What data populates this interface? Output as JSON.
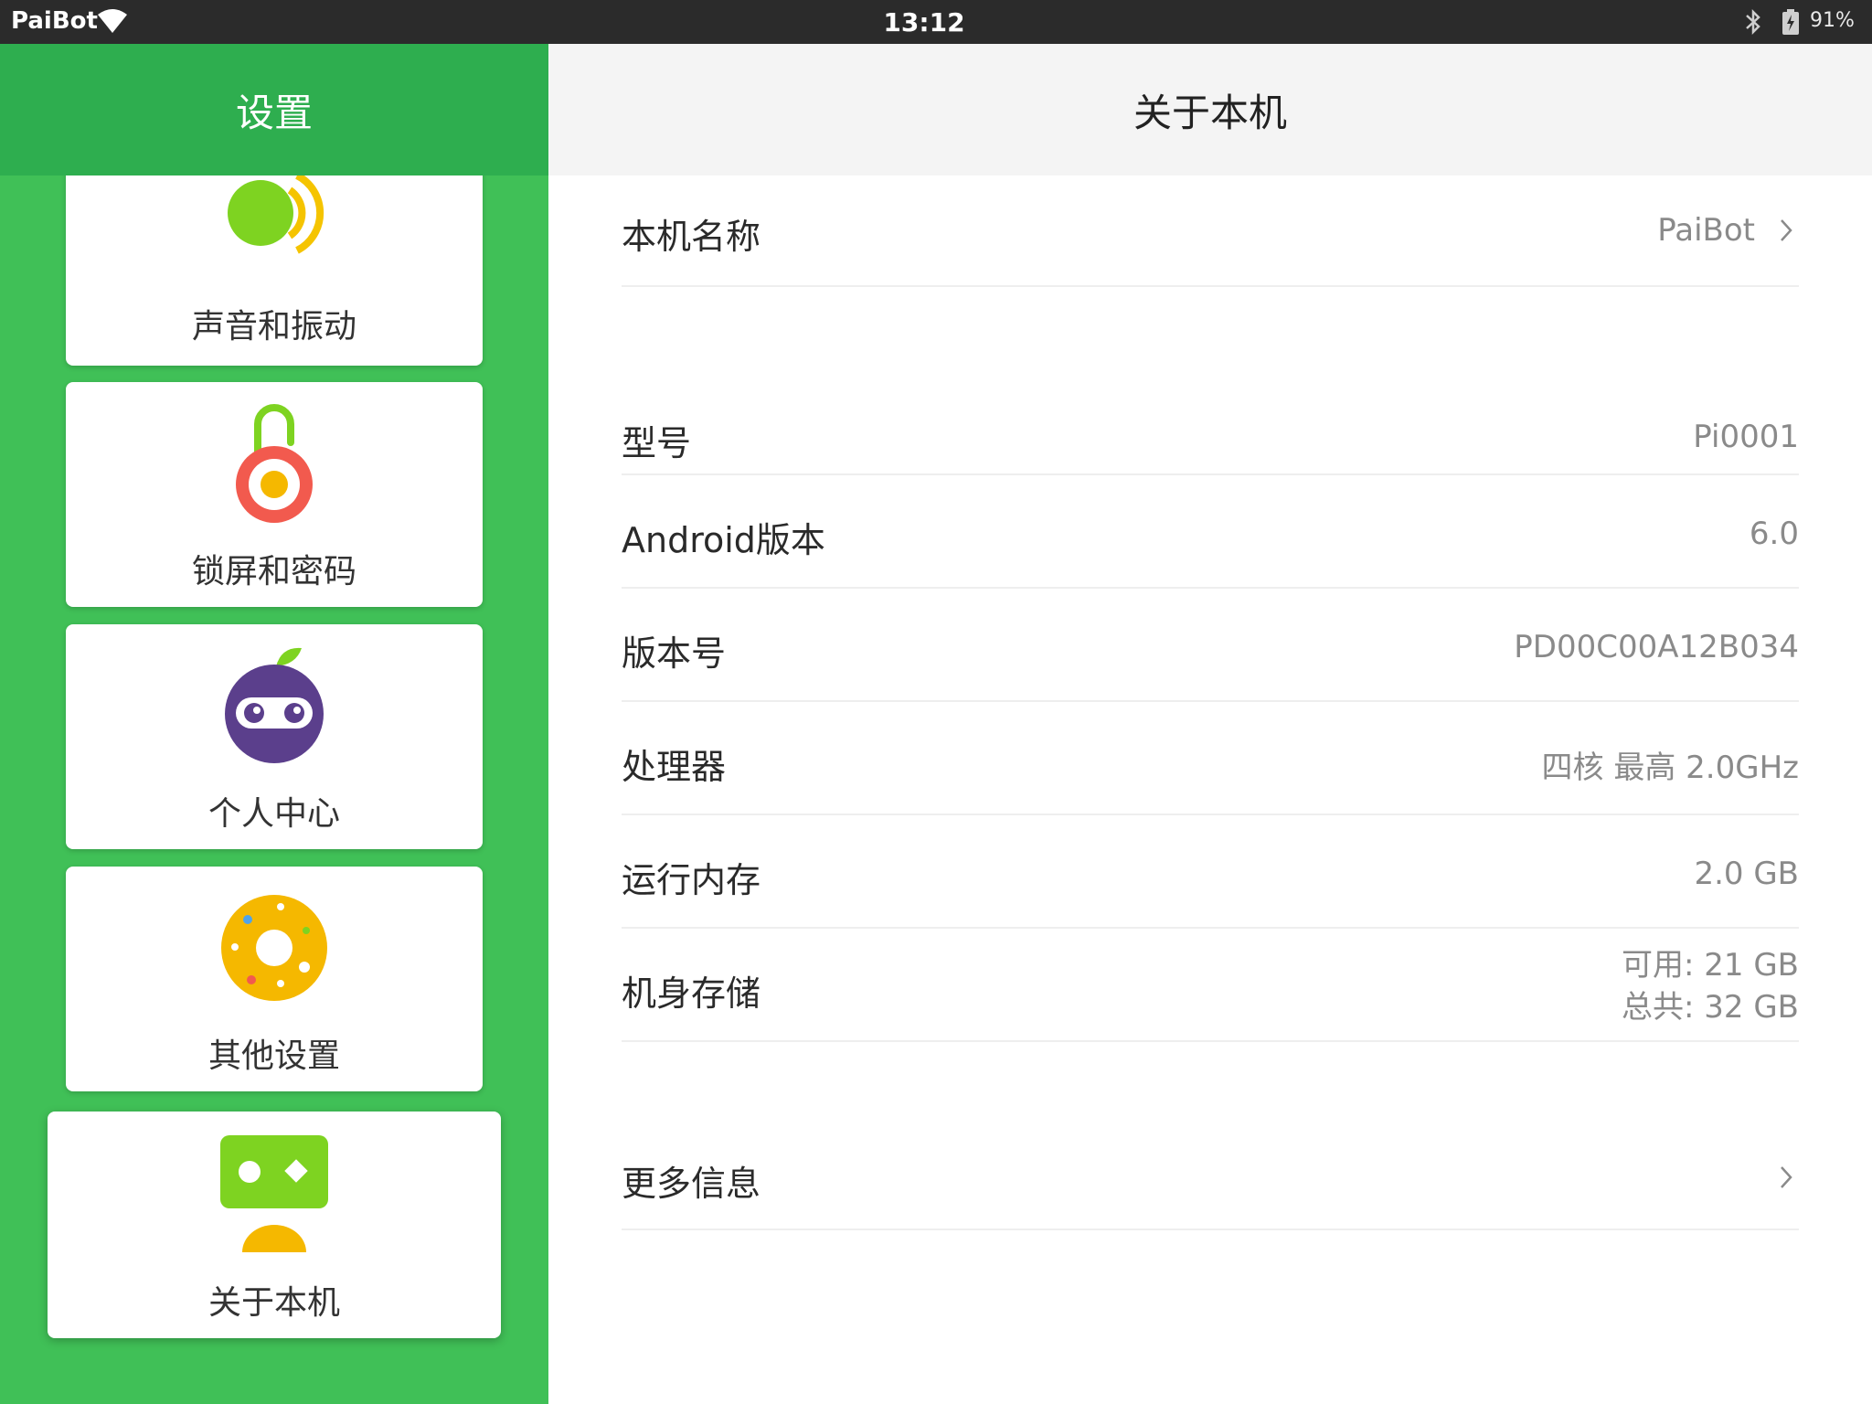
{
  "status_bar": {
    "carrier": "PaiBot",
    "time": "13:12",
    "battery": "91%"
  },
  "sidebar": {
    "title": "设置",
    "items": [
      {
        "label": "声音和振动",
        "icon": "sound-vibration-icon"
      },
      {
        "label": "锁屏和密码",
        "icon": "lock-icon"
      },
      {
        "label": "个人中心",
        "icon": "profile-ninja-icon"
      },
      {
        "label": "其他设置",
        "icon": "donut-icon"
      },
      {
        "label": "关于本机",
        "icon": "robot-icon",
        "selected": true
      }
    ]
  },
  "main": {
    "title": "关于本机",
    "rows": [
      {
        "label": "本机名称",
        "value": "PaiBot"
      },
      {
        "label": "型号",
        "value": "Pi0001"
      },
      {
        "label": "Android版本",
        "value": "6.0"
      },
      {
        "label": "版本号",
        "value": "PD00C00A12B034"
      },
      {
        "label": "处理器",
        "value": "四核 最高 2.0GHz"
      },
      {
        "label": "运行内存",
        "value": "2.0 GB"
      },
      {
        "label": "机身存储",
        "value_line1": "可用: 21 GB",
        "value_line2": "总共: 32 GB"
      },
      {
        "label": "更多信息"
      }
    ]
  },
  "colors": {
    "sidebar_bg": "#40c057",
    "sidebar_header_bg": "#2eae4f",
    "main_header_bg": "#f4f4f4"
  }
}
